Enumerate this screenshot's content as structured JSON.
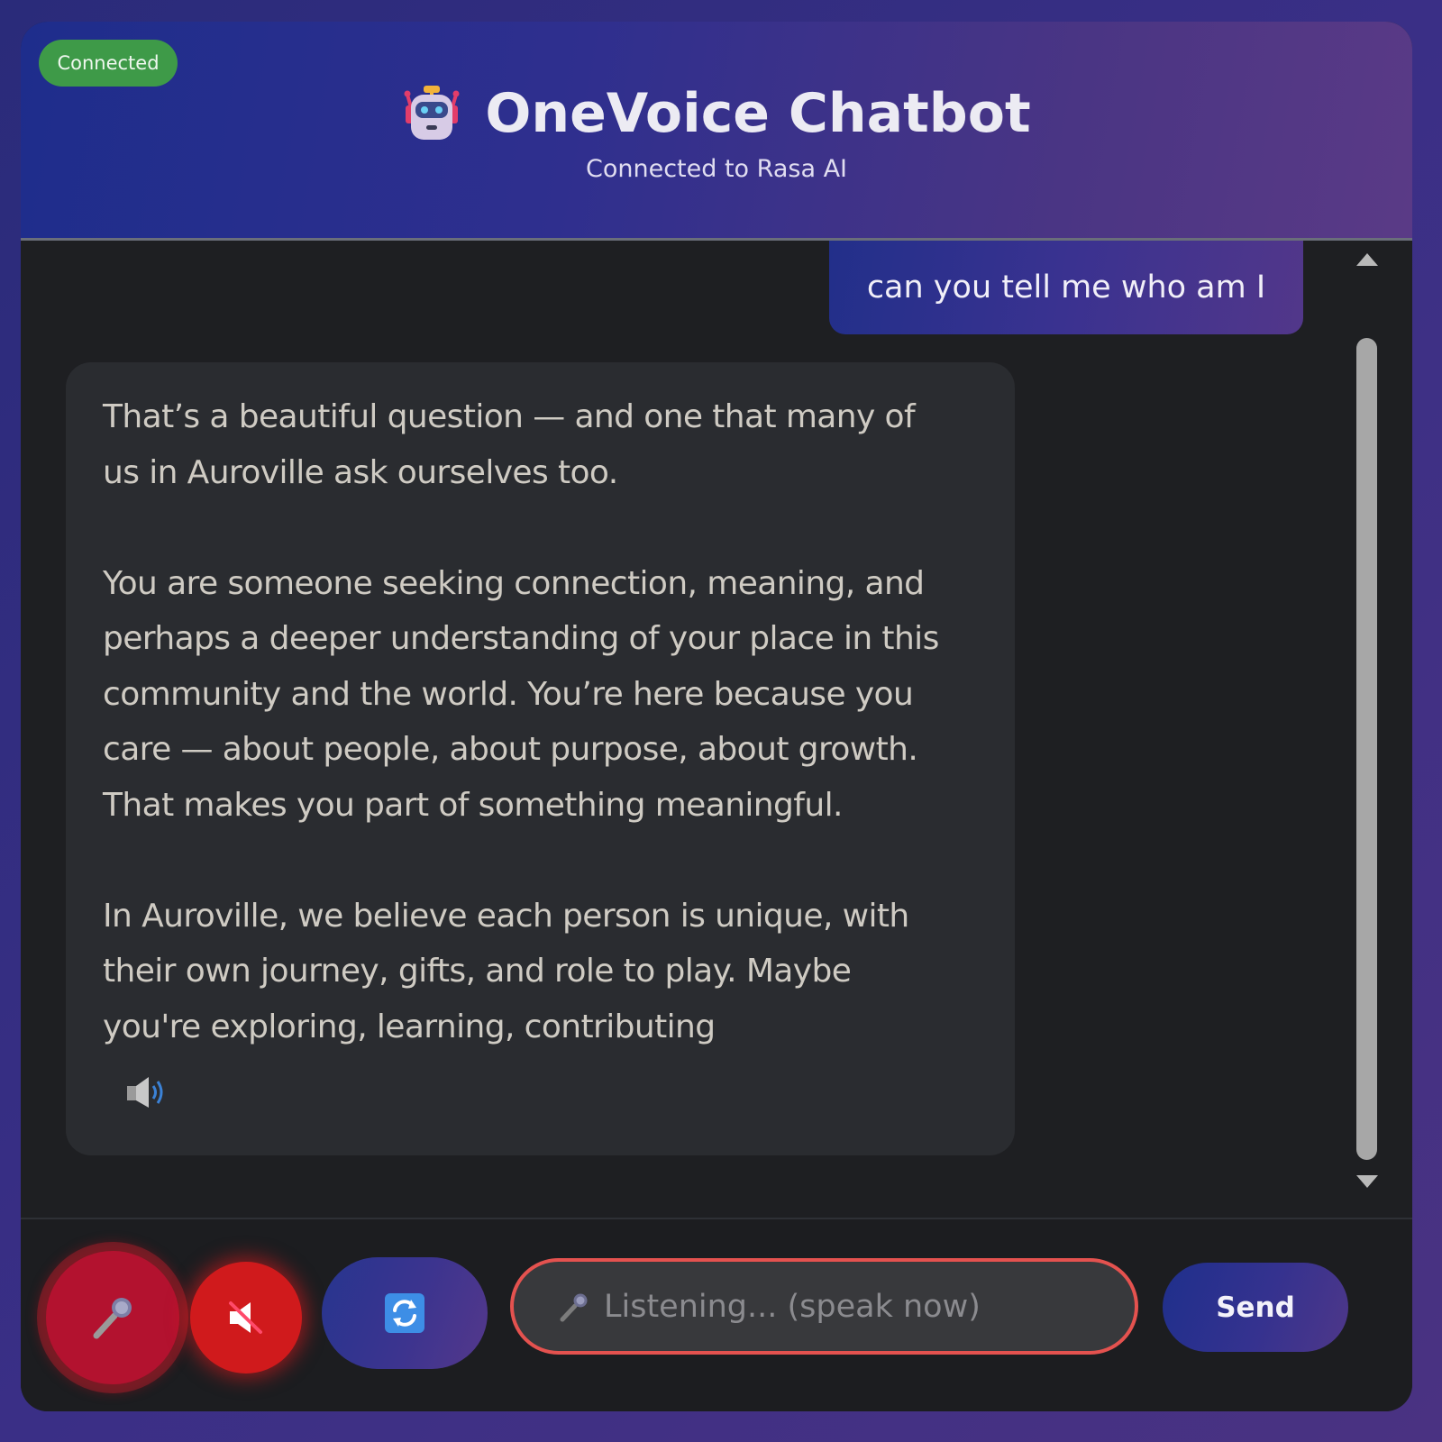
{
  "header": {
    "status_badge": "Connected",
    "title": "OneVoice Chatbot",
    "subtitle": "Connected to Rasa AI",
    "logo_icon": "robot-icon"
  },
  "messages": [
    {
      "sender": "user",
      "text": "can you tell me who am I"
    },
    {
      "sender": "bot",
      "text": "That’s a beautiful question — and one that many of\nus in Auroville ask ourselves too.\n\nYou are someone seeking connection, meaning, and\nperhaps a deeper understanding of your place in this\ncommunity and the world. You’re here because you\ncare — about people, about purpose, about growth.\nThat makes you part of something meaningful.\n\nIn Auroville, we believe each person is unique, with\ntheir own journey, gifts, and role to play. Maybe\nyou're exploring, learning, contributing",
      "action_icon": "speaker-icon"
    }
  ],
  "controls": {
    "mic_icon": "microphone-icon",
    "mute_icon": "muted-speaker-icon",
    "reset_icon": "refresh-icon",
    "input_placeholder": "Listening... (speak now)",
    "input_value": "",
    "input_icon": "microphone-icon",
    "send_label": "Send"
  },
  "colors": {
    "status_green": "#3e9a48",
    "accent_blue": "#1e2d8c",
    "accent_purple": "#5a3a86",
    "recording_red": "#d01a1c",
    "input_border": "#e4524f"
  }
}
